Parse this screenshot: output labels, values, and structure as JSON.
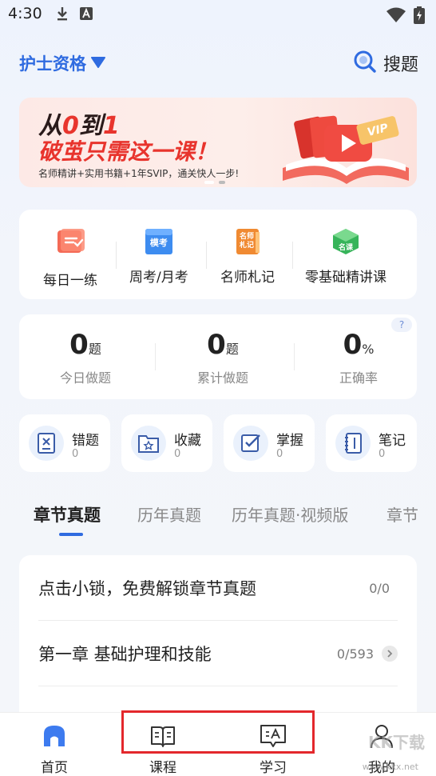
{
  "status_bar": {
    "time": "4:30",
    "icons": [
      "download-icon",
      "text-a-icon",
      "wifi-icon",
      "battery-charging-icon"
    ]
  },
  "header": {
    "exam_selector": "护士资格",
    "search_label": "搜题"
  },
  "banner": {
    "line1_prefix": "从",
    "line1_zero": "0",
    "line1_mid": "到",
    "line1_one": "1",
    "line2": "破茧只需这一课！",
    "line3": "名师精讲+实用书籍+1年SVIP，通关快人一步!",
    "badge": "VIP",
    "colors": {
      "accent": "#e8342d"
    }
  },
  "quick_actions": [
    {
      "label": "每日一练",
      "icon": "daily-practice-icon"
    },
    {
      "label": "周考/月考",
      "icon": "weekly-exam-icon",
      "icon_text": "模考"
    },
    {
      "label": "名师札记",
      "icon": "teacher-notes-icon",
      "icon_text": "名师札记"
    },
    {
      "label": "零基础精讲课",
      "icon": "basic-course-icon",
      "icon_text": "名课"
    }
  ],
  "stats": {
    "help": "?",
    "items": [
      {
        "value": "0",
        "unit": "题",
        "label": "今日做题"
      },
      {
        "value": "0",
        "unit": "题",
        "label": "累计做题"
      },
      {
        "value": "0",
        "unit": "%",
        "label": "正确率"
      }
    ]
  },
  "shortcuts": [
    {
      "title": "错题",
      "count": "0",
      "icon": "wrong-questions-icon"
    },
    {
      "title": "收藏",
      "count": "0",
      "icon": "favorites-icon"
    },
    {
      "title": "掌握",
      "count": "0",
      "icon": "mastered-icon"
    },
    {
      "title": "笔记",
      "count": "0",
      "icon": "notes-icon"
    }
  ],
  "tabs": [
    {
      "label": "章节真题",
      "active": true
    },
    {
      "label": "历年真题",
      "active": false
    },
    {
      "label": "历年真题·视频版",
      "active": false
    },
    {
      "label": "章节",
      "active": false
    }
  ],
  "chapters": [
    {
      "title": "点击小锁，免费解锁章节真题",
      "count": "0/0"
    },
    {
      "title": "第一章 基础护理和技能",
      "count": "0/593"
    }
  ],
  "bottom_nav": [
    {
      "label": "首页",
      "icon": "home-icon",
      "active": true
    },
    {
      "label": "课程",
      "icon": "book-icon",
      "active": false
    },
    {
      "label": "学习",
      "icon": "study-icon",
      "active": false
    },
    {
      "label": "我的",
      "icon": "profile-icon",
      "active": false
    }
  ],
  "watermark": {
    "text": "KK下载",
    "sub": "www.kkx.net"
  },
  "colors": {
    "primary": "#2f6be0",
    "highlight": "#e3282c"
  }
}
